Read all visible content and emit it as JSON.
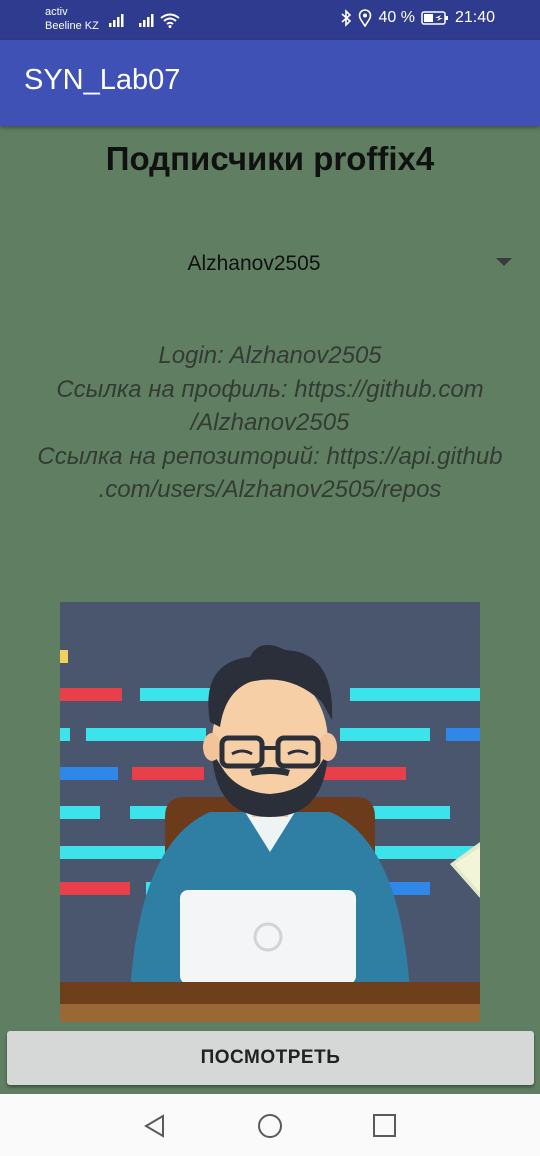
{
  "status_bar": {
    "carrier_line1": "activ",
    "carrier_line2": "Beeline KZ",
    "battery": "40 %",
    "time": "21:40",
    "icons": [
      "signal-icon",
      "wifi-icon",
      "bluetooth-icon",
      "location-icon",
      "battery-icon"
    ]
  },
  "app_bar": {
    "title": "SYN_Lab07"
  },
  "main": {
    "heading": "Подписчики proffix4",
    "spinner": {
      "selected": "Alzhanov2505"
    },
    "info": {
      "login": "Login: Alzhanov2505",
      "profile_line1": "Ссылка на профиль: https://github.com",
      "profile_line2": "/Alzhanov2505",
      "repo_line1": "Ссылка на репозиторий: https://api.github",
      "repo_line2": ".com/users/Alzhanov2505/repos"
    },
    "button_label": "ПОСМОТРЕТЬ"
  },
  "colors": {
    "status_bar": "#2e3b8f",
    "app_bar": "#3f51b5",
    "background": "#607f62",
    "button": "#d6d7d7"
  },
  "nav_bar": {
    "icons": [
      "back-icon",
      "home-icon",
      "recents-icon"
    ]
  }
}
